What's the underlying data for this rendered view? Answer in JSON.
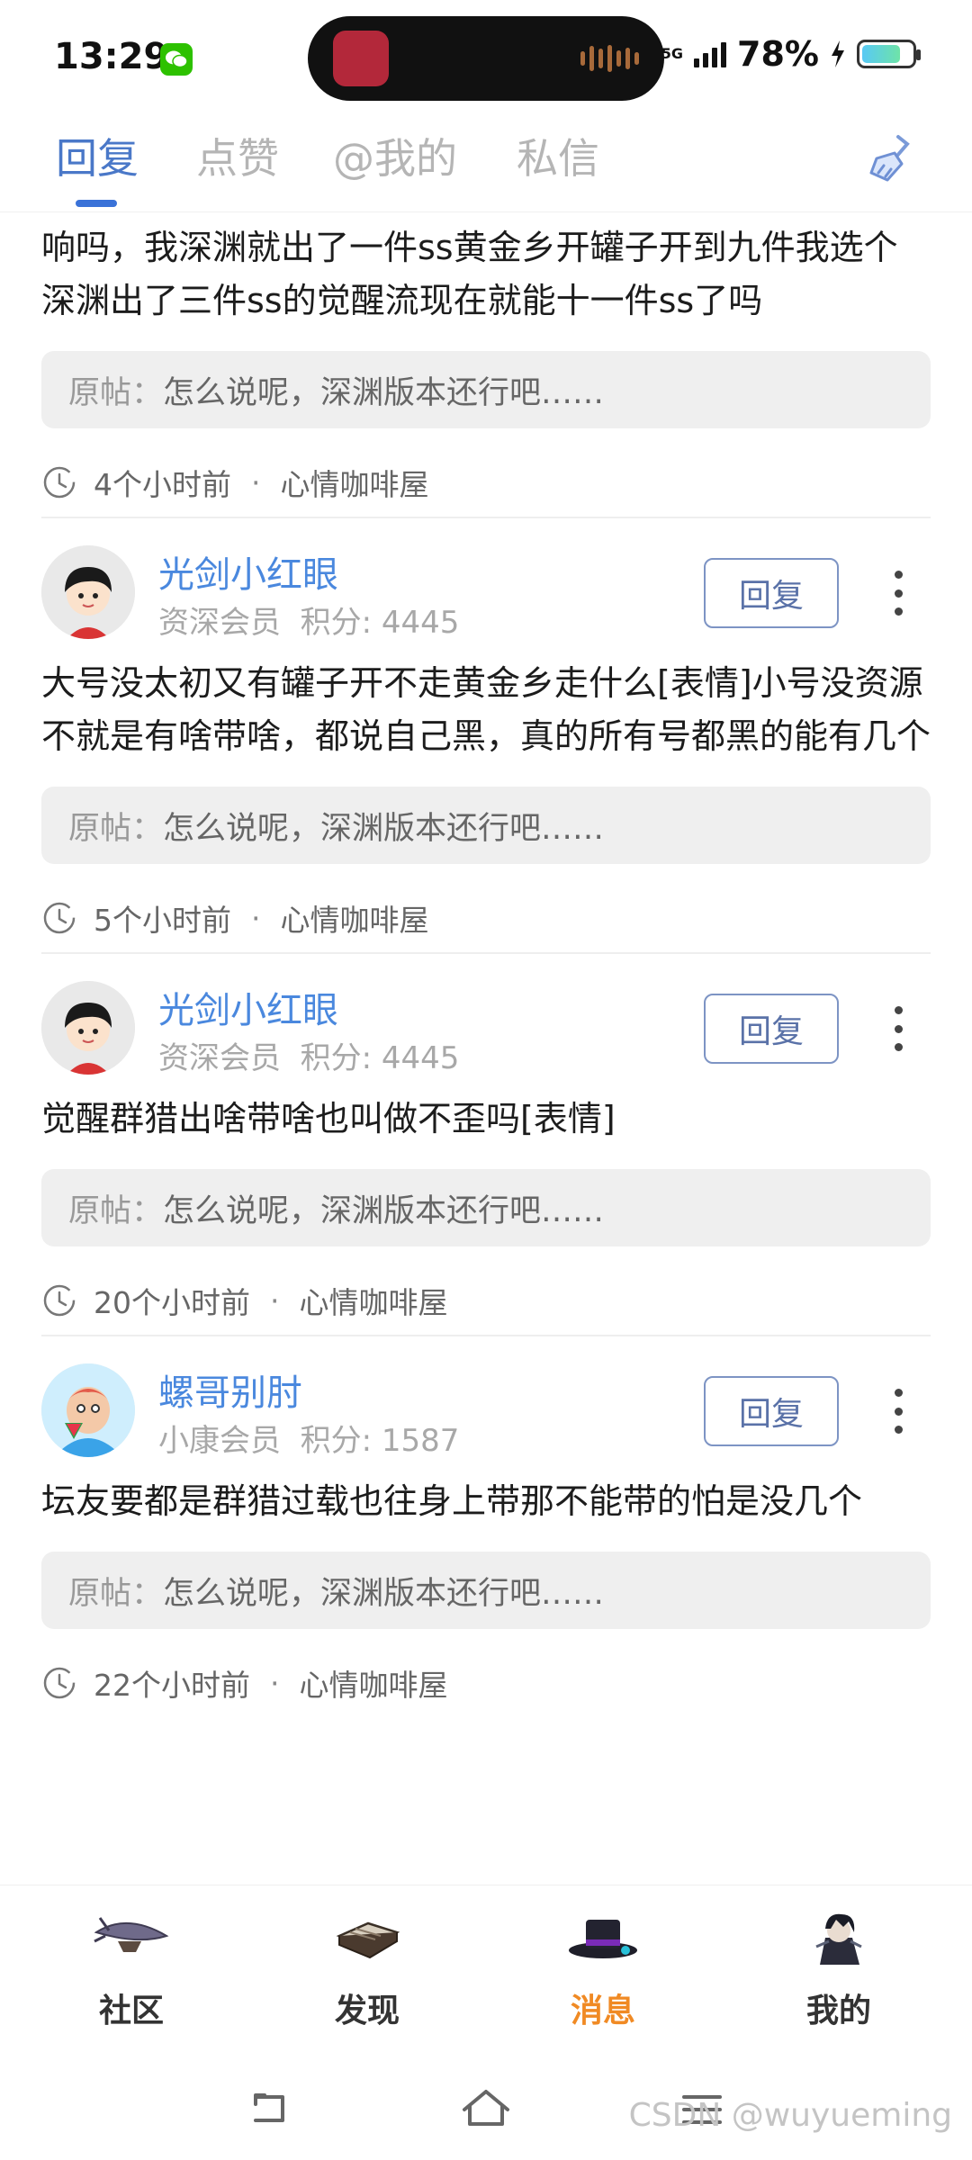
{
  "status_bar": {
    "time": "13:29",
    "network": "5G",
    "battery": "78%",
    "battery_level": 0.78
  },
  "tabs": [
    {
      "label": "回复",
      "active": true
    },
    {
      "label": "点赞",
      "active": false
    },
    {
      "label": "@我的",
      "active": false
    },
    {
      "label": "私信",
      "active": false
    }
  ],
  "clear_icon": "broom-icon",
  "replies": [
    {
      "partial": true,
      "content": "响吗，我深渊就出了一件ss黄金乡开罐子开到九件我选个深渊出了三件ss的觉醒流现在就能十一件ss了吗",
      "quote_label": "原帖：",
      "quote_text": "怎么说呢，深渊版本还行吧……",
      "time": "4个小时前",
      "forum": "心情咖啡屋"
    },
    {
      "username": "光剑小红眼",
      "member": "资深会员",
      "points": "积分: 4445",
      "reply_label": "回复",
      "content": "大号没太初又有罐子开不走黄金乡走什么[表情]小号没资源不就是有啥带啥，都说自己黑，真的所有号都黑的能有几个",
      "quote_label": "原帖：",
      "quote_text": "怎么说呢，深渊版本还行吧……",
      "time": "5个小时前",
      "forum": "心情咖啡屋"
    },
    {
      "username": "光剑小红眼",
      "member": "资深会员",
      "points": "积分: 4445",
      "reply_label": "回复",
      "content": "觉醒群猎出啥带啥也叫做不歪吗[表情]",
      "quote_label": "原帖：",
      "quote_text": "怎么说呢，深渊版本还行吧……",
      "time": "20个小时前",
      "forum": "心情咖啡屋"
    },
    {
      "username": "螺哥别肘",
      "member": "小康会员",
      "points": "积分: 1587",
      "reply_label": "回复",
      "content": "坛友要都是群猎过载也往身上带那不能带的怕是没几个",
      "quote_label": "原帖：",
      "quote_text": "怎么说呢，深渊版本还行吧……",
      "time": "22个小时前",
      "forum": "心情咖啡屋"
    }
  ],
  "bottom_nav": [
    {
      "label": "社区",
      "icon": "airship-icon",
      "active": false
    },
    {
      "label": "发现",
      "icon": "book-icon",
      "active": false
    },
    {
      "label": "消息",
      "icon": "hat-icon",
      "active": true
    },
    {
      "label": "我的",
      "icon": "character-icon",
      "active": false
    }
  ],
  "watermark": "CSDN @wuyueming",
  "colors": {
    "accent_blue": "#4a78c8",
    "username_blue": "#4a88de",
    "active_orange": "#f08a24"
  }
}
